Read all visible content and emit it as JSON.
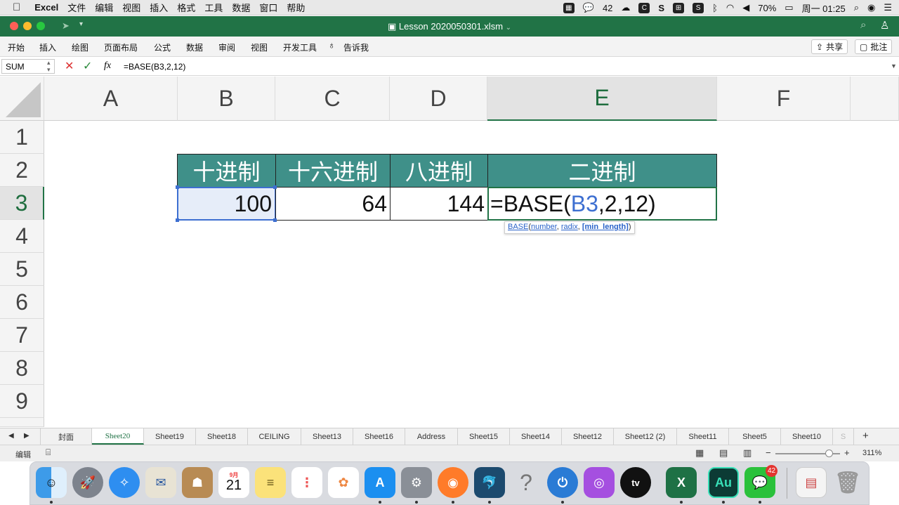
{
  "menubar": {
    "app": "Excel",
    "items": [
      "文件",
      "编辑",
      "视图",
      "插入",
      "格式",
      "工具",
      "数据",
      "窗口",
      "帮助"
    ],
    "wechat_count": "42",
    "battery": "70%",
    "clock": "周一 01:25"
  },
  "window": {
    "title": "Lesson 2020050301.xlsm"
  },
  "ribbon": {
    "tabs": [
      "开始",
      "插入",
      "绘图",
      "页面布局",
      "公式",
      "数据",
      "审阅",
      "视图",
      "开发工具"
    ],
    "tell_me": "告诉我",
    "share": "共享",
    "comments": "批注"
  },
  "formula_bar": {
    "name_box": "SUM",
    "fx": "fx",
    "formula": "=BASE(B3,2,12)"
  },
  "columns": [
    "A",
    "B",
    "C",
    "D",
    "E",
    "F"
  ],
  "rows": [
    "1",
    "2",
    "3",
    "4",
    "5",
    "6",
    "7",
    "8",
    "9"
  ],
  "table": {
    "headers": [
      "十进制",
      "十六进制",
      "八进制",
      "二进制"
    ],
    "values": [
      "100",
      "64",
      "144"
    ],
    "edit_prefix": "=BASE(",
    "edit_ref": "B3",
    "edit_suffix": ",2,12)"
  },
  "tooltip": {
    "fn": "BASE",
    "args": [
      "number",
      "radix",
      "[min_length]"
    ]
  },
  "sheets": [
    "封面",
    "Sheet20",
    "Sheet19",
    "Sheet18",
    "CEILING",
    "Sheet13",
    "Sheet16",
    "Address",
    "Sheet15",
    "Sheet14",
    "Sheet12",
    "Sheet12 (2)",
    "Sheet11",
    "Sheet5",
    "Sheet10"
  ],
  "status": {
    "mode": "编辑",
    "zoom": "311%"
  },
  "dock": {
    "calendar_month": "9月",
    "calendar_day": "21",
    "wechat_badge": "42"
  }
}
